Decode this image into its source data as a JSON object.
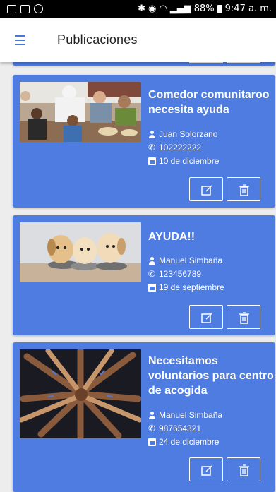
{
  "status_bar": {
    "battery_pct": "88%",
    "time": "9:47 a. m."
  },
  "appbar": {
    "title": "Publicaciones"
  },
  "posts": [
    {
      "title": "Comedor comunitaroo necesita ayuda",
      "author": "Juan Solorzano",
      "phone": "102222222",
      "date": "10 de diciembre",
      "image_icon": "community-dining-photo"
    },
    {
      "title": "AYUDA!!",
      "author": "Manuel Simbaña",
      "phone": "123456789",
      "date": "19 de septiembre",
      "image_icon": "puppies-photo"
    },
    {
      "title": "Necesitamos voluntarios para centro de acogida",
      "author": "Manuel Simbaña",
      "phone": "987654321",
      "date": "24 de diciembre",
      "image_icon": "volunteer-hands-photo"
    }
  ],
  "colors": {
    "card": "#4f7ce0",
    "accent": "#4a78d6"
  }
}
